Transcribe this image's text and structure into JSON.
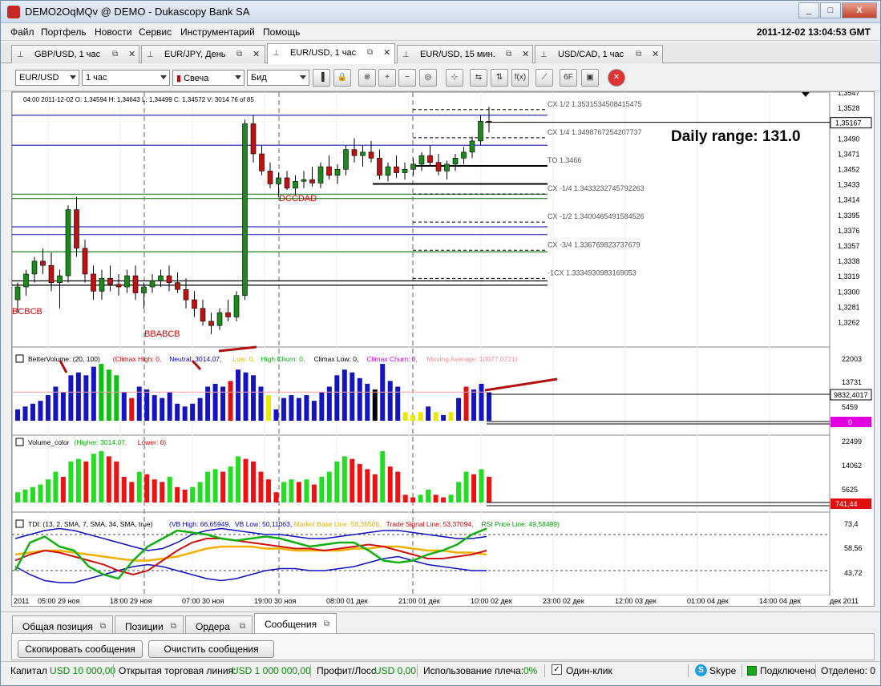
{
  "window": {
    "title": "DEMO2OqMQv @ DEMO - Dukascopy Bank SA",
    "buttons": {
      "minimize": "_",
      "maximize": "□",
      "close": "X"
    }
  },
  "menu": {
    "items": [
      "Файл",
      "Портфель",
      "Новости",
      "Сервис",
      "Инструментарий",
      "Помощь"
    ],
    "clock": "2011-12-02 13:04:53 GMT"
  },
  "chart_tabs": [
    {
      "label": "GBP/USD,  1 час",
      "active": false
    },
    {
      "label": "EUR/JPY,  День",
      "active": false
    },
    {
      "label": "EUR/USD,  1 час",
      "active": true
    },
    {
      "label": "EUR/USD,  15 мин.",
      "active": false
    },
    {
      "label": "USD/CAD,  1 час",
      "active": false
    }
  ],
  "toolbar": {
    "instrument": "EUR/USD",
    "period": "1 час",
    "chart_type": "Свеча",
    "price_side": "Бид",
    "icons": [
      "bar-chart-icon",
      "lock-icon",
      "zoom-fit-icon",
      "zoom-in-icon",
      "zoom-out-icon",
      "zoom-range-icon",
      "cursor-icon",
      "shift-icon",
      "scale-icon",
      "formula-icon",
      "pattern-icon",
      "fibonacci-icon",
      "save-template-icon",
      "stop-icon"
    ],
    "icon_glyphs": [
      "▐",
      "🔒",
      "⊕",
      "+",
      "−",
      "◎",
      "⊹",
      "⇆",
      "⇅",
      "f(x)",
      "⟋",
      "6F",
      "▣",
      "✕"
    ]
  },
  "chart": {
    "info_line": {
      "time": "04:00 2011-12-02",
      "open": "O: 1,34594",
      "high": "H: 1,34643",
      "low": "L: 1,34499",
      "close": "C: 1,34572",
      "volume": "V: 3014",
      "count": "76 of 85"
    },
    "daily_range": "Daily range: 131.0",
    "current_price": "1,35167",
    "pattern_labels": [
      "BCBCB",
      "BBABCB",
      "DCCDAD"
    ],
    "level_labels": [
      "CX 1/2 1.3531534508415475",
      "CX 1/4 1.3498767254207737",
      "TO 1.3466",
      "CX -1/4 1.3433232745792263",
      "CX -1/2 1.3400465491584526",
      "CX -3/4 1.336769823737679",
      "-1CX 1.3334930983169053"
    ],
    "price_axis": [
      "1,3547",
      "1,3528",
      "1,3509",
      "1,3490",
      "1,3471",
      "1,3452",
      "1,3433",
      "1,3414",
      "1,3395",
      "1,3376",
      "1,3357",
      "1,3338",
      "1,3319",
      "1,3300",
      "1,3281",
      "1,3262"
    ],
    "time_axis": [
      "2011",
      "05:00 29 ноя",
      "18:00 29 ноя",
      "07:00 30 ноя",
      "19:00 30 ноя",
      "08:00 01 дек",
      "21:00 01 дек",
      "10:00 02 дек",
      "23:00 02 дек",
      "12:00 03 дек",
      "01:00 04 дек",
      "14:00 04 дек",
      "дек 2011"
    ],
    "volume_indicator": {
      "title": "BetterVolume: (20, 100)",
      "parts": [
        {
          "text": "(Climax High: 0,",
          "color": "#d00000"
        },
        {
          "text": " Neutral: 3014,07,",
          "color": "#0000c0"
        },
        {
          "text": " Low: 0,",
          "color": "#c8c800"
        },
        {
          "text": " High Churn: 0,",
          "color": "#00b000"
        },
        {
          "text": " Climax Low: 0,",
          "color": "#000000"
        },
        {
          "text": " Climax Churn: 0,",
          "color": "#d000d0"
        },
        {
          "text": " Moving Average: 10077,0721)",
          "color": "#f09090"
        }
      ],
      "axis": [
        "22003",
        "13731",
        "5459"
      ],
      "ma_value": "9832,4017",
      "zero_label": "0"
    },
    "volume_color": {
      "title": "Volume_color",
      "parts": [
        {
          "text": " (Higher: 3014,07,",
          "color": "#00b000"
        },
        {
          "text": " Lower: 0)",
          "color": "#d00000"
        }
      ],
      "axis": [
        "22499",
        "14062",
        "5625"
      ],
      "value": "741,44"
    },
    "tdi": {
      "title": "TDI: (13, 2, SMA, 7, SMA, 34, SMA, true)",
      "parts": [
        {
          "text": " (VB High: 66,65949,",
          "color": "#0000c0"
        },
        {
          "text": " VB Low: 50,11063,",
          "color": "#0000c0"
        },
        {
          "text": " Market Base Line: 58,36506,",
          "color": "#e0b000"
        },
        {
          "text": " Trade Signal Line: 53,37094,",
          "color": "#d00000"
        },
        {
          "text": " RSI Price Line: 49,58499)",
          "color": "#00a000"
        }
      ],
      "axis": [
        "73,4",
        "58,56",
        "43,72"
      ]
    }
  },
  "bottom_tabs": [
    {
      "label": "Общая позиция",
      "active": false
    },
    {
      "label": "Позиции",
      "active": false
    },
    {
      "label": "Ордера",
      "active": false
    },
    {
      "label": "Сообщения",
      "active": true
    }
  ],
  "message_panel": {
    "copy_button": "Скопировать сообщения",
    "clear_button": "Очистить сообщения"
  },
  "status": {
    "capital_label": "Капитал",
    "capital_value": "USD 10 000,00",
    "open_line_label": "Открытая торговая линия:",
    "open_line_value": "USD 1 000 000,00",
    "pl_label": "Профит/Лосс",
    "pl_value": "USD 0,00",
    "leverage_label": "Использование плеча:",
    "leverage_value": "0%",
    "one_click_label": "Один-клик",
    "skype_label": "Skype",
    "connected_label": "Подключено",
    "detached_label": "Отделено: 0"
  },
  "chart_data": [
    {
      "type": "candlestick",
      "title": "EUR/USD, 1 час",
      "ylim": [
        1.3255,
        1.355
      ],
      "current_price": 1.35167,
      "levels": [
        1.3531534508415475,
        1.3498767254207737,
        1.3466,
        1.3433232745792263,
        1.3400465491584526,
        1.336769823737679,
        1.3334930983169053
      ],
      "candles": [
        [
          1.331,
          1.333,
          1.3295,
          1.3325
        ],
        [
          1.3325,
          1.3345,
          1.3315,
          1.334
        ],
        [
          1.334,
          1.336,
          1.333,
          1.3355
        ],
        [
          1.3355,
          1.337,
          1.334,
          1.335
        ],
        [
          1.335,
          1.3365,
          1.332,
          1.333
        ],
        [
          1.333,
          1.3345,
          1.33,
          1.3338
        ],
        [
          1.3338,
          1.342,
          1.333,
          1.3415
        ],
        [
          1.3415,
          1.343,
          1.336,
          1.337
        ],
        [
          1.337,
          1.338,
          1.333,
          1.334
        ],
        [
          1.334,
          1.335,
          1.331,
          1.332
        ],
        [
          1.332,
          1.3345,
          1.331,
          1.3335
        ],
        [
          1.3335,
          1.335,
          1.332,
          1.3328
        ],
        [
          1.3328,
          1.334,
          1.3315,
          1.3325
        ],
        [
          1.3325,
          1.3345,
          1.3318,
          1.3338
        ],
        [
          1.3338,
          1.335,
          1.331,
          1.3318
        ],
        [
          1.3318,
          1.333,
          1.33,
          1.3325
        ],
        [
          1.3325,
          1.334,
          1.3318,
          1.3332
        ],
        [
          1.3332,
          1.3345,
          1.3325,
          1.3338
        ],
        [
          1.3338,
          1.335,
          1.332,
          1.333
        ],
        [
          1.333,
          1.3342,
          1.3318,
          1.3322
        ],
        [
          1.3322,
          1.3335,
          1.33,
          1.331
        ],
        [
          1.331,
          1.332,
          1.329,
          1.33
        ],
        [
          1.33,
          1.331,
          1.328,
          1.3285
        ],
        [
          1.3285,
          1.3295,
          1.327,
          1.328
        ],
        [
          1.328,
          1.33,
          1.3275,
          1.3295
        ],
        [
          1.3295,
          1.331,
          1.3285,
          1.329
        ],
        [
          1.329,
          1.332,
          1.3285,
          1.3315
        ],
        [
          1.3315,
          1.352,
          1.331,
          1.3515
        ],
        [
          1.3515,
          1.3525,
          1.347,
          1.348
        ],
        [
          1.348,
          1.349,
          1.3455,
          1.346
        ],
        [
          1.346,
          1.347,
          1.344,
          1.3445
        ],
        [
          1.3445,
          1.3458,
          1.343,
          1.3452
        ],
        [
          1.3452,
          1.346,
          1.3438,
          1.344
        ],
        [
          1.344,
          1.3455,
          1.3432,
          1.3448
        ],
        [
          1.3448,
          1.346,
          1.344,
          1.345
        ],
        [
          1.345,
          1.3465,
          1.3442,
          1.3446
        ],
        [
          1.3446,
          1.347,
          1.344,
          1.3465
        ],
        [
          1.3465,
          1.3478,
          1.345,
          1.3455
        ],
        [
          1.3455,
          1.3468,
          1.3445,
          1.3462
        ],
        [
          1.3462,
          1.349,
          1.3455,
          1.3485
        ],
        [
          1.3485,
          1.3498,
          1.347,
          1.3478
        ],
        [
          1.3478,
          1.349,
          1.3465,
          1.3482
        ],
        [
          1.3482,
          1.3495,
          1.347,
          1.3475
        ],
        [
          1.3475,
          1.3485,
          1.345,
          1.3455
        ],
        [
          1.3455,
          1.347,
          1.3448,
          1.3465
        ],
        [
          1.3465,
          1.3478,
          1.3452,
          1.3458
        ],
        [
          1.3458,
          1.347,
          1.345,
          1.3462
        ],
        [
          1.3462,
          1.3475,
          1.3455,
          1.3468
        ],
        [
          1.3468,
          1.3482,
          1.346,
          1.3478
        ],
        [
          1.3478,
          1.349,
          1.3465,
          1.347
        ],
        [
          1.347,
          1.348,
          1.3455,
          1.346
        ],
        [
          1.346,
          1.3472,
          1.345,
          1.3468
        ],
        [
          1.3468,
          1.348,
          1.346,
          1.3475
        ],
        [
          1.3475,
          1.3488,
          1.3468,
          1.3482
        ],
        [
          1.3482,
          1.35,
          1.3475,
          1.3495
        ],
        [
          1.3495,
          1.3525,
          1.349,
          1.3518
        ],
        [
          1.3518,
          1.3535,
          1.3505,
          1.3517
        ]
      ]
    },
    {
      "type": "bar",
      "title": "BetterVolume: (20, 100)",
      "ma": 10077.0721,
      "values": [
        4000,
        5000,
        6000,
        7000,
        9000,
        12000,
        10000,
        16000,
        17000,
        16000,
        19000,
        20000,
        18000,
        16000,
        10000,
        8000,
        12000,
        11000,
        9000,
        8000,
        10000,
        6000,
        5000,
        6000,
        8000,
        12000,
        13000,
        12000,
        14000,
        18000,
        17000,
        16000,
        12000,
        9000,
        4000,
        8000,
        9000,
        8000,
        9000,
        7000,
        10000,
        12000,
        16000,
        18000,
        17000,
        15000,
        13000,
        11000,
        20000,
        14000,
        12000,
        3000,
        2000,
        3000,
        5000,
        3000,
        2000,
        3000,
        8000,
        12000,
        11000,
        13000,
        10000
      ]
    },
    {
      "type": "bar",
      "title": "Volume_color",
      "values": [
        4000,
        5000,
        6000,
        7000,
        9000,
        12000,
        10000,
        16000,
        17000,
        16000,
        19000,
        20000,
        18000,
        16000,
        10000,
        8000,
        12000,
        11000,
        9000,
        8000,
        10000,
        6000,
        5000,
        6000,
        8000,
        12000,
        13000,
        12000,
        14000,
        18000,
        17000,
        16000,
        12000,
        9000,
        4000,
        8000,
        9000,
        8000,
        9000,
        7000,
        10000,
        12000,
        16000,
        18000,
        17000,
        15000,
        13000,
        11000,
        20000,
        14000,
        12000,
        3000,
        2000,
        3000,
        5000,
        3000,
        2000,
        3000,
        8000,
        12000,
        11000,
        13000,
        10000
      ]
    },
    {
      "type": "line",
      "title": "TDI",
      "series": [
        {
          "name": "VB High",
          "values": [
            66,
            68,
            70,
            71,
            70,
            68,
            66,
            64,
            62,
            60,
            61,
            64,
            68,
            70,
            71,
            70,
            69,
            68,
            68,
            67,
            66,
            66,
            67,
            68,
            69,
            70,
            70,
            69,
            68,
            67,
            66,
            66,
            67
          ]
        },
        {
          "name": "VB Low",
          "values": [
            52,
            48,
            45,
            44,
            44,
            46,
            48,
            50,
            52,
            53,
            52,
            50,
            48,
            46,
            45,
            46,
            48,
            50,
            51,
            51,
            50,
            50,
            51,
            52,
            54,
            56,
            57,
            55,
            53,
            52,
            51,
            50,
            50
          ]
        },
        {
          "name": "Market Base Line",
          "values": [
            58,
            59,
            60,
            60,
            59,
            58,
            57,
            56,
            55,
            55,
            56,
            57,
            59,
            61,
            62,
            62,
            62,
            61,
            61,
            60,
            60,
            60,
            60,
            61,
            61,
            62,
            62,
            61,
            60,
            60,
            59,
            59,
            58
          ]
        },
        {
          "name": "Trade Signal Line",
          "values": [
            55,
            58,
            60,
            59,
            57,
            55,
            53,
            50,
            48,
            50,
            55,
            60,
            64,
            66,
            66,
            65,
            64,
            63,
            62,
            61,
            61,
            60,
            61,
            62,
            63,
            62,
            60,
            58,
            56,
            56,
            57,
            58,
            60
          ]
        },
        {
          "name": "RSI Price Line",
          "values": [
            50,
            64,
            67,
            62,
            60,
            52,
            48,
            46,
            55,
            62,
            66,
            70,
            69,
            68,
            66,
            65,
            66,
            67,
            66,
            64,
            62,
            63,
            64,
            64,
            60,
            55,
            54,
            55,
            58,
            60,
            63,
            68,
            71
          ]
        }
      ]
    }
  ]
}
